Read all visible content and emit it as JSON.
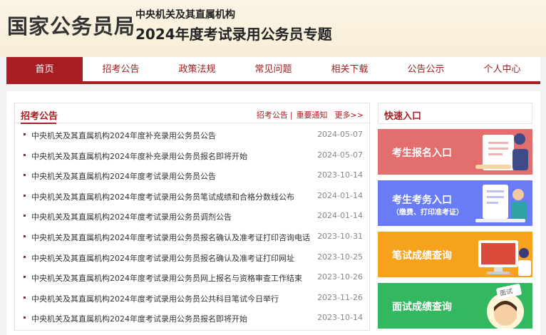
{
  "header": {
    "logo": "国家公务员局",
    "subtitle1": "中央机关及其直属机构",
    "subtitle2": "2024年度考试录用公务员专题"
  },
  "nav": {
    "items": [
      "首页",
      "招考公告",
      "政策法规",
      "常见问题",
      "相关下载",
      "公告公示",
      "个人中心"
    ],
    "active": "首页"
  },
  "announcements": {
    "title": "招考公告",
    "link1": "招考公告",
    "separator": "|",
    "link2": "重要通知",
    "more": "更多>>",
    "rows": [
      {
        "title": "中央机关及其直属机构2024年度补充录用公务员公告",
        "date": "2024-05-07"
      },
      {
        "title": "中央机关及其直属机构2024年度补充录用公务员报名即将开始",
        "date": "2024-05-07"
      },
      {
        "title": "中央机关及其直属机构2024年度考试录用公务员公告",
        "date": "2023-10-14"
      },
      {
        "title": "中央机关及其直属机构2024年度考试录用公务员笔试成绩和合格分数线公布",
        "date": "2024-01-14"
      },
      {
        "title": "中央机关及其直属机构2024年度考试录用公务员调剂公告",
        "date": "2024-01-14"
      },
      {
        "title": "中央机关及其直属机构2024年度考试录用公务员报名确认及准考证打印咨询电话",
        "date": "2023-10-31"
      },
      {
        "title": "中央机关及其直属机构2024年度考试录用公务员报名确认及准考证打印网址",
        "date": "2023-10-25"
      },
      {
        "title": "中央机关及其直属机构2024年度考试录用公务员网上报名与资格审查工作结束",
        "date": "2023-10-26"
      },
      {
        "title": "中央机关及其直属机构2024年度考试录用公务员公共科目笔试今日举行",
        "date": "2023-11-26"
      },
      {
        "title": "中央机关及其直属机构2024年度考试录用公务员报名即将开始",
        "date": "2023-10-14"
      }
    ]
  },
  "quick": {
    "title": "快速入口",
    "banners": [
      {
        "label": "考生报名入口",
        "sub": "",
        "color": "#e26e6e"
      },
      {
        "label": "考生考务入口",
        "sub": "（缴费、打印准考证）",
        "color": "#6a7cf5"
      },
      {
        "label": "笔试成绩查询",
        "sub": "",
        "color": "#f7a21c"
      },
      {
        "label": "面试成绩查询",
        "sub": "",
        "color": "#33b85f"
      }
    ],
    "interview_sign": "面试"
  },
  "colors": {
    "brand_red": "#a91e22",
    "header_bg": "#fbf3e4"
  }
}
